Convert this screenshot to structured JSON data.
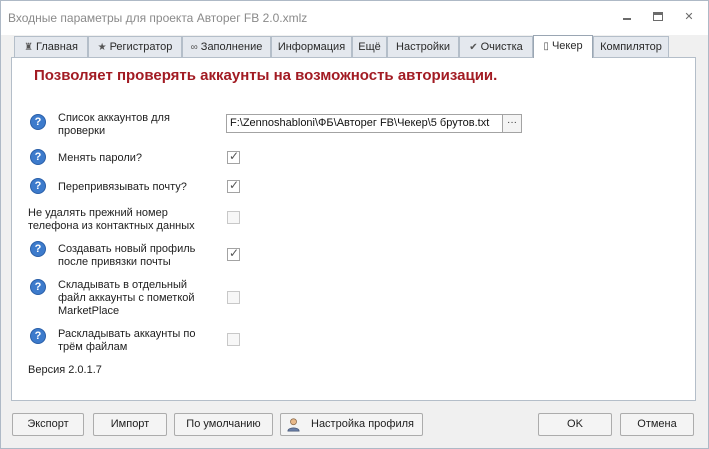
{
  "window": {
    "title": "Входные параметры для проекта Авторег FB 2.0.xmlz"
  },
  "tabs": [
    {
      "label": "Главная",
      "icon": "home-icon",
      "active": false
    },
    {
      "label": "Регистратор",
      "icon": "star-icon",
      "active": false
    },
    {
      "label": "Заполнение",
      "icon": "infinity-icon",
      "active": false
    },
    {
      "label": "Информация",
      "icon": "",
      "active": false
    },
    {
      "label": "Ещё",
      "icon": "",
      "active": false
    },
    {
      "label": "Настройки",
      "icon": "",
      "active": false
    },
    {
      "label": "Очистка",
      "icon": "check-icon",
      "active": false
    },
    {
      "label": "Чекер",
      "icon": "document-icon",
      "active": true
    },
    {
      "label": "Компилятор",
      "icon": "",
      "active": false
    }
  ],
  "panel": {
    "description": "Позволяет проверять аккаунты на возможность авторизации.",
    "accounts_list": {
      "label": "Список аккаунтов для проверки",
      "value": "F:\\Zennoshabloni\\ФБ\\Авторег FB\\Чекер\\5 брутов.txt",
      "browse_label": "···"
    },
    "options": [
      {
        "label": "Менять пароли?",
        "checked": true,
        "enabled": true,
        "help": true
      },
      {
        "label": "Перепривязывать почту?",
        "checked": true,
        "enabled": true,
        "help": true
      },
      {
        "label": "Не удалять прежний номер телефона из контактных данных",
        "checked": false,
        "enabled": false,
        "help": false
      },
      {
        "label": "Создавать новый профиль после привязки почты",
        "checked": true,
        "enabled": true,
        "help": true
      },
      {
        "label": "Складывать в отдельный файл аккаунты с пометкой MarketPlace",
        "checked": false,
        "enabled": false,
        "help": true
      },
      {
        "label": "Раскладывать аккаунты по трём файлам",
        "checked": false,
        "enabled": false,
        "help": true
      }
    ],
    "version": "Версия 2.0.1.7"
  },
  "buttons": {
    "export": "Экспорт",
    "import": "Импорт",
    "defaults": "По умолчанию",
    "profile_settings": "Настройка профиля",
    "ok": "OK",
    "cancel": "Отмена"
  },
  "colors": {
    "description_text": "#a21b23",
    "help_icon": "#3d7bcc"
  }
}
